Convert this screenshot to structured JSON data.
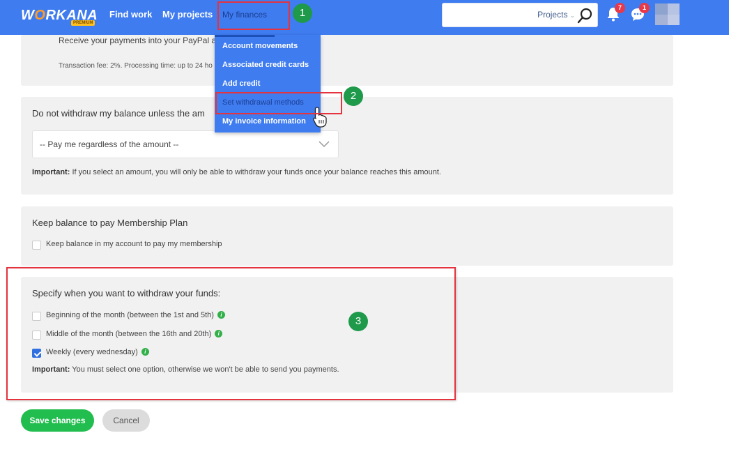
{
  "nav": {
    "logo": "WORKANA",
    "logo_badge": "PREMIUM",
    "find_work": "Find work",
    "my_projects": "My projects",
    "my_finances": "My finances",
    "search_scope": "Projects",
    "notifications_count": "7",
    "messages_count": "1"
  },
  "finance_menu": {
    "items": [
      "Account movements",
      "Associated credit cards",
      "Add credit",
      "Set withdrawal methods",
      "My invoice information"
    ]
  },
  "paypal_panel": {
    "receive_text": "Receive your payments into your PayPal ac",
    "fee_text": "Transaction fee: 2%. Processing time: up to 24 ho"
  },
  "min_balance_panel": {
    "title": "Do not withdraw my balance unless the am",
    "select_value": "-- Pay me regardless of the amount --",
    "important_label": "Important:",
    "important_text": " If you select an amount, you will only be able to withdraw your funds once your balance reaches this amount."
  },
  "membership_panel": {
    "title": "Keep balance to pay Membership Plan",
    "checkbox_label": "Keep balance in my account to pay my membership",
    "checked": false
  },
  "schedule_panel": {
    "title": "Specify when you want to withdraw your funds:",
    "options": [
      {
        "label": "Beginning of the month (between the 1st and 5th)",
        "checked": false
      },
      {
        "label": "Middle of the month (between the 16th and 20th)",
        "checked": false
      },
      {
        "label": "Weekly (every wednesday)",
        "checked": true
      }
    ],
    "important_label": "Important:",
    "important_text": " You must select one option, otherwise we won't be able to send you payments."
  },
  "actions": {
    "save": "Save changes",
    "cancel": "Cancel"
  },
  "annotations": {
    "step1": "1",
    "step2": "2",
    "step3": "3"
  },
  "colors": {
    "brand_blue": "#3f7cf0",
    "save_green": "#21bd4e",
    "annotation_red": "#e3343f",
    "annotation_green": "#1e9a4a"
  }
}
